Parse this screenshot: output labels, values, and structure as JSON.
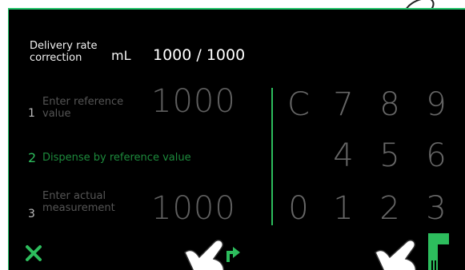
{
  "header": {
    "label": "Delivery rate correction",
    "unit": "mL",
    "value": "1000 / 1000"
  },
  "steps": [
    {
      "number": "1",
      "label": "Enter reference value",
      "value": "1000"
    },
    {
      "number": "2",
      "label": "Dispense by reference value"
    },
    {
      "number": "3",
      "label": "Enter actual measurement",
      "value": "1000"
    }
  ],
  "keypad": {
    "row1": [
      "C",
      "7",
      "8",
      "9"
    ],
    "row2": [
      "4",
      "5",
      "6"
    ],
    "row3": [
      "0",
      "1",
      "2",
      "3"
    ]
  },
  "footer": {
    "cancel_icon": "close-icon",
    "forward_icon": "turn-right-arrow-icon",
    "pump_icon": "pump-icon"
  },
  "colors": {
    "accent": "#2dbd5d",
    "background": "#000000"
  }
}
